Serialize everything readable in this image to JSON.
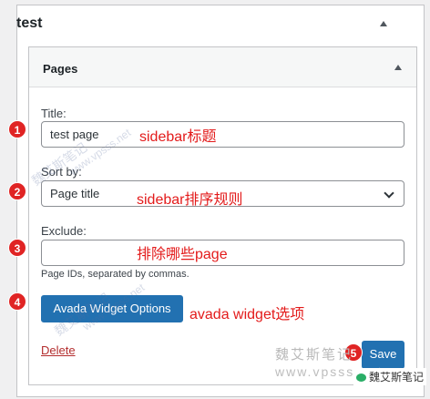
{
  "widget": {
    "title": "test"
  },
  "panel": {
    "title": "Pages"
  },
  "fields": {
    "title_label": "Title:",
    "title_value": "test page",
    "sort_label": "Sort by:",
    "sort_value": "Page title",
    "exclude_label": "Exclude:",
    "exclude_value": "",
    "exclude_hint": "Page IDs, separated by commas."
  },
  "buttons": {
    "avada_options": "Avada Widget Options",
    "delete": "Delete",
    "save": "Save"
  },
  "annotations": {
    "badges": [
      "1",
      "2",
      "3",
      "4",
      "5"
    ],
    "note_title": "sidebar标题",
    "note_sort": "sidebar排序规则",
    "note_exclude": "排除哪些page",
    "note_avada": "avada widget选项"
  },
  "watermarks": {
    "site_cn": "魏艾斯笔记",
    "site_url": "www.vpsss.net",
    "wechat": "魏艾斯笔记"
  },
  "colors": {
    "primary": "#2271b1",
    "badge": "#e02424",
    "note": "#e31b1b",
    "delete": "#b32d2e"
  },
  "icons": [
    "collapse-arrow-icon",
    "dropdown-caret-icon",
    "wechat-icon"
  ]
}
